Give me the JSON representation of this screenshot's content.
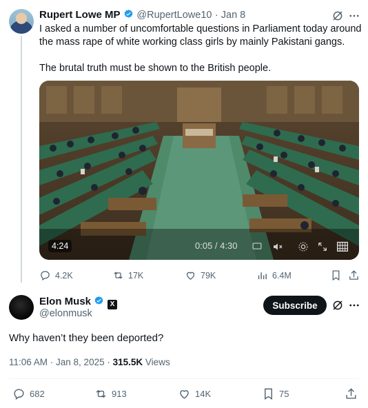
{
  "parent_tweet": {
    "name": "Rupert Lowe MP",
    "handle": "@RupertLowe10",
    "date": "· Jan 8",
    "text_line1": "I asked a number of uncomfortable questions in Parliament today around",
    "text_line2": "the mass rape of white working class girls by mainly Pakistani gangs.",
    "text_line3": "The brutal truth must be shown to the British people.",
    "video": {
      "duration_badge": "4:24",
      "progress": "0:05 / 4:30"
    },
    "stats": {
      "replies": "4.2K",
      "reposts": "17K",
      "likes": "79K",
      "views": "6.4M"
    }
  },
  "reply_tweet": {
    "name": "Elon Musk",
    "handle": "@elonmusk",
    "subscribe_label": "Subscribe",
    "text": "Why haven’t they been deported?",
    "time": "11:06 AM · Jan 8, 2025 ·",
    "views_count": "315.5K",
    "views_label": "Views",
    "stats": {
      "replies": "682",
      "reposts": "913",
      "likes": "14K",
      "bookmarks": "75"
    }
  },
  "colors": {
    "verified": "#1d9bf0",
    "muted": "#536471",
    "accent_dark": "#0f1419"
  }
}
